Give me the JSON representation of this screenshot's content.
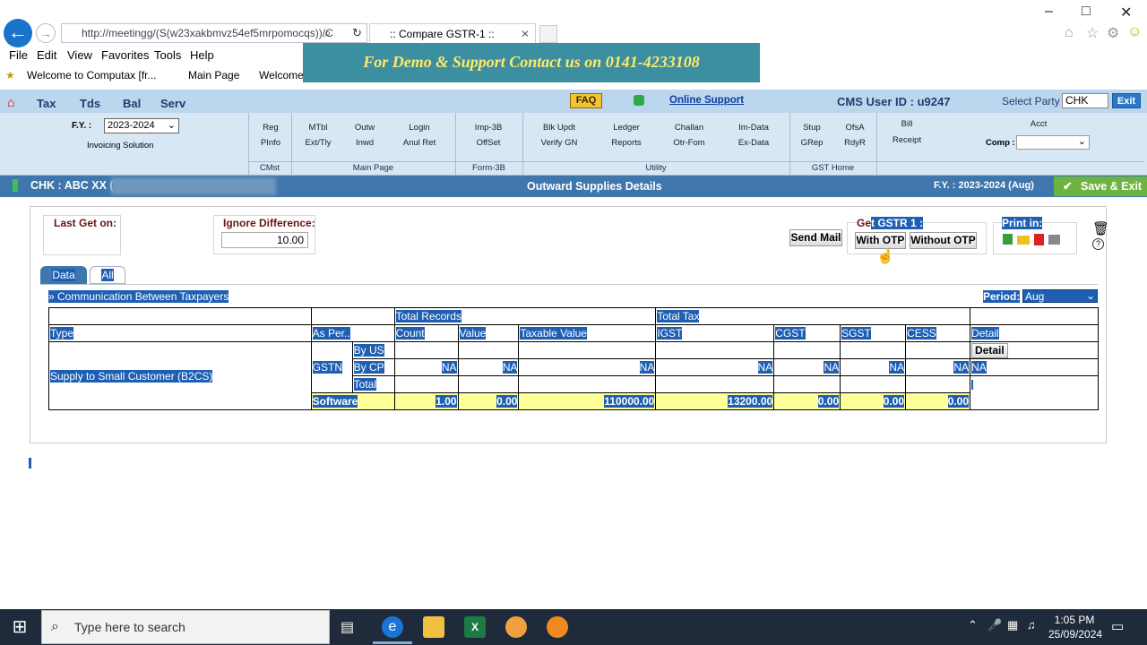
{
  "browser": {
    "url": "http://meetingg/(S(w23xakbmvz54ef5mrpomocqs))/C",
    "tab_title": ":: Compare GSTR-1 ::",
    "menu": [
      "File",
      "Edit",
      "View",
      "Favorites",
      "Tools",
      "Help"
    ],
    "favorites": [
      "Welcome to Computax [fr...",
      "Main Page",
      "Welcome"
    ]
  },
  "banner": "For Demo & Support Contact us on 0141-4233108",
  "app": {
    "top_menu": [
      "Tax",
      "Tds",
      "Bal",
      "Serv"
    ],
    "faq": "FAQ",
    "online_support": "Online Support",
    "cms_user": "CMS User ID : u9247",
    "select_party_label": "Select Party",
    "party_value": "CHK",
    "exit": "Exit",
    "fy_label": "F.Y. :",
    "fy_value": "2023-2024",
    "invoicing": "Invoicing Solution",
    "toolbar_items": [
      [
        "Reg",
        "PInfo"
      ],
      [
        "MTbl",
        "Ext/Tly"
      ],
      [
        "Outw",
        "Inwd"
      ],
      [
        "Login",
        "Anul Ret"
      ],
      [
        "Imp-3B",
        "OffSet"
      ],
      [
        "Blk Updt",
        "Verify GN"
      ],
      [
        "Ledger",
        "Reports"
      ],
      [
        "Challan",
        "Otr-Fom"
      ],
      [
        "Im-Data",
        "Ex-Data"
      ],
      [
        "Stup",
        "GRep"
      ],
      [
        "OfsA",
        "RdyR"
      ],
      [
        "Bill",
        "Receipt"
      ],
      [
        "Acct"
      ]
    ],
    "sections": [
      "CMst",
      "Main Page",
      "Form-3B",
      "Utility",
      "GST Home"
    ],
    "comp_label": "Comp :"
  },
  "title_bar": {
    "left": "CHK : ABC XX (",
    "center": "Outward Supplies Details",
    "right": "F.Y. : 2023-2024 (Aug)",
    "save": "Save & Exit"
  },
  "panel": {
    "last_get_label": "Last Get on:",
    "ignore_label": "Ignore Difference:",
    "ignore_value": "10.00",
    "send_mail": "Send Mail",
    "get_label": "Ge",
    "gstr_label": "t GSTR 1 :",
    "with_otp": "With OTP",
    "without_otp": "Without OTP",
    "print_label": "Print in:",
    "tab_data": "Data",
    "tab_all": "All",
    "section_title": "» Communication Between Taxpayers",
    "period_label": "Period:",
    "period_value": "Aug"
  },
  "table": {
    "group_headers": {
      "records": "Total Records",
      "tax": "Total Tax"
    },
    "headers": [
      "Type",
      "As Per..",
      "Count",
      "Value",
      "Taxable Value",
      "IGST",
      "CGST",
      "SGST",
      "CESS",
      "Detail"
    ],
    "type": "Supply to Small Customer (B2CS)",
    "gstn": "GSTN",
    "by_us": "By US",
    "by_cp": "By CP",
    "total": "Total",
    "na": "NA",
    "detail_btn": "Detail",
    "software": "Software",
    "software_values": [
      "1.00",
      "0.00",
      "110000.00",
      "13200.00",
      "0.00",
      "0.00",
      "0.00"
    ]
  },
  "taskbar": {
    "search": "Type here to search",
    "time": "1:05 PM",
    "date": "25/09/2024"
  }
}
